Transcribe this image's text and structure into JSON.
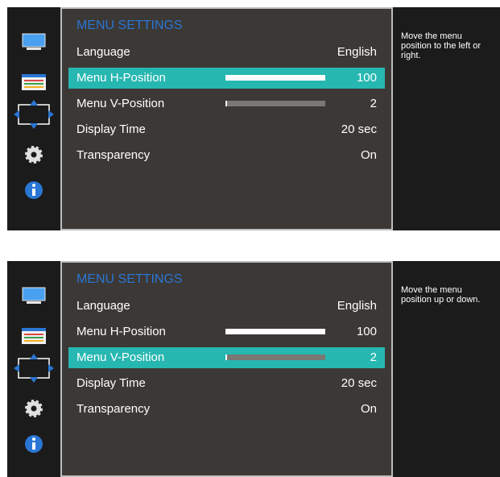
{
  "panels": [
    {
      "title": "MENU SETTINGS",
      "help": [
        "Move the menu",
        "position to the left or",
        "right."
      ],
      "selected": 1,
      "items": [
        {
          "label": "Language",
          "value": "English",
          "level": null
        },
        {
          "label": "Menu H-Position",
          "value": "100",
          "level": 100
        },
        {
          "label": "Menu V-Position",
          "value": "2",
          "level": 2
        },
        {
          "label": "Display Time",
          "value": "20 sec",
          "level": null
        },
        {
          "label": "Transparency",
          "value": "On",
          "level": null
        }
      ]
    },
    {
      "title": "MENU SETTINGS",
      "help": [
        "Move the menu",
        "position up or down."
      ],
      "selected": 2,
      "items": [
        {
          "label": "Language",
          "value": "English",
          "level": null
        },
        {
          "label": "Menu H-Position",
          "value": "100",
          "level": 100
        },
        {
          "label": "Menu V-Position",
          "value": "2",
          "level": 2
        },
        {
          "label": "Display Time",
          "value": "20 sec",
          "level": null
        },
        {
          "label": "Transparency",
          "value": "On",
          "level": null
        }
      ]
    }
  ],
  "sidebar_icons": [
    "monitor-icon",
    "color-settings-icon",
    "move-arrows-icon",
    "gear-icon",
    "info-icon"
  ],
  "colors": {
    "title": "#2a76d4",
    "selected_row": "#27b7b1",
    "menu_bg": "#3c3835",
    "side_bg": "#1b1b1b"
  }
}
